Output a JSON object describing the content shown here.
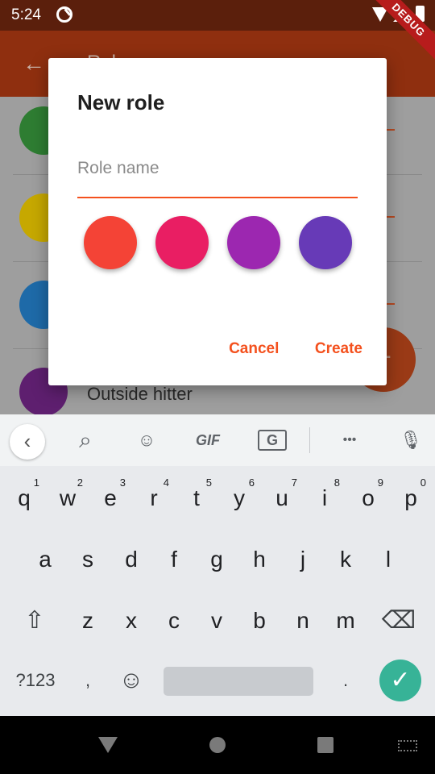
{
  "status_bar": {
    "time": "5:24",
    "debug_label": "DEBUG"
  },
  "app_bar": {
    "title": "Roles",
    "back_glyph": "←"
  },
  "list": {
    "items": [
      {
        "label": "",
        "color": "#2e7d32"
      },
      {
        "label": "",
        "color": "#c6a800"
      },
      {
        "label": "",
        "color": "#1e6aa8"
      },
      {
        "label": "Outside hitter",
        "color": "#5e1f6f"
      }
    ],
    "fab_glyph": "+"
  },
  "dialog": {
    "title": "New role",
    "input": {
      "value": "",
      "placeholder": "Role name"
    },
    "colors": [
      "#f44336",
      "#e91e63",
      "#9c27b0",
      "#673ab7"
    ],
    "cancel_label": "Cancel",
    "create_label": "Create",
    "accent": "#f4511e"
  },
  "keyboard": {
    "toolbar": {
      "collapse_glyph": "‹",
      "search_glyph": "⌕",
      "sticker_glyph": "☺",
      "gif_label": "GIF",
      "translate_glyph": "G",
      "more_glyph": "•••",
      "mic_glyph": "🎙"
    },
    "row1": [
      {
        "key": "q",
        "hint": "1"
      },
      {
        "key": "w",
        "hint": "2"
      },
      {
        "key": "e",
        "hint": "3"
      },
      {
        "key": "r",
        "hint": "4"
      },
      {
        "key": "t",
        "hint": "5"
      },
      {
        "key": "y",
        "hint": "6"
      },
      {
        "key": "u",
        "hint": "7"
      },
      {
        "key": "i",
        "hint": "8"
      },
      {
        "key": "o",
        "hint": "9"
      },
      {
        "key": "p",
        "hint": "0"
      }
    ],
    "row2": [
      "a",
      "s",
      "d",
      "f",
      "g",
      "h",
      "j",
      "k",
      "l"
    ],
    "row3": [
      "z",
      "x",
      "c",
      "v",
      "b",
      "n",
      "m"
    ],
    "shift_glyph": "⇧",
    "backspace_glyph": "⌫",
    "symbols_label": "?123",
    "comma_label": ",",
    "emoji_glyph": "☺",
    "period_label": ".",
    "enter_glyph": "✓"
  }
}
